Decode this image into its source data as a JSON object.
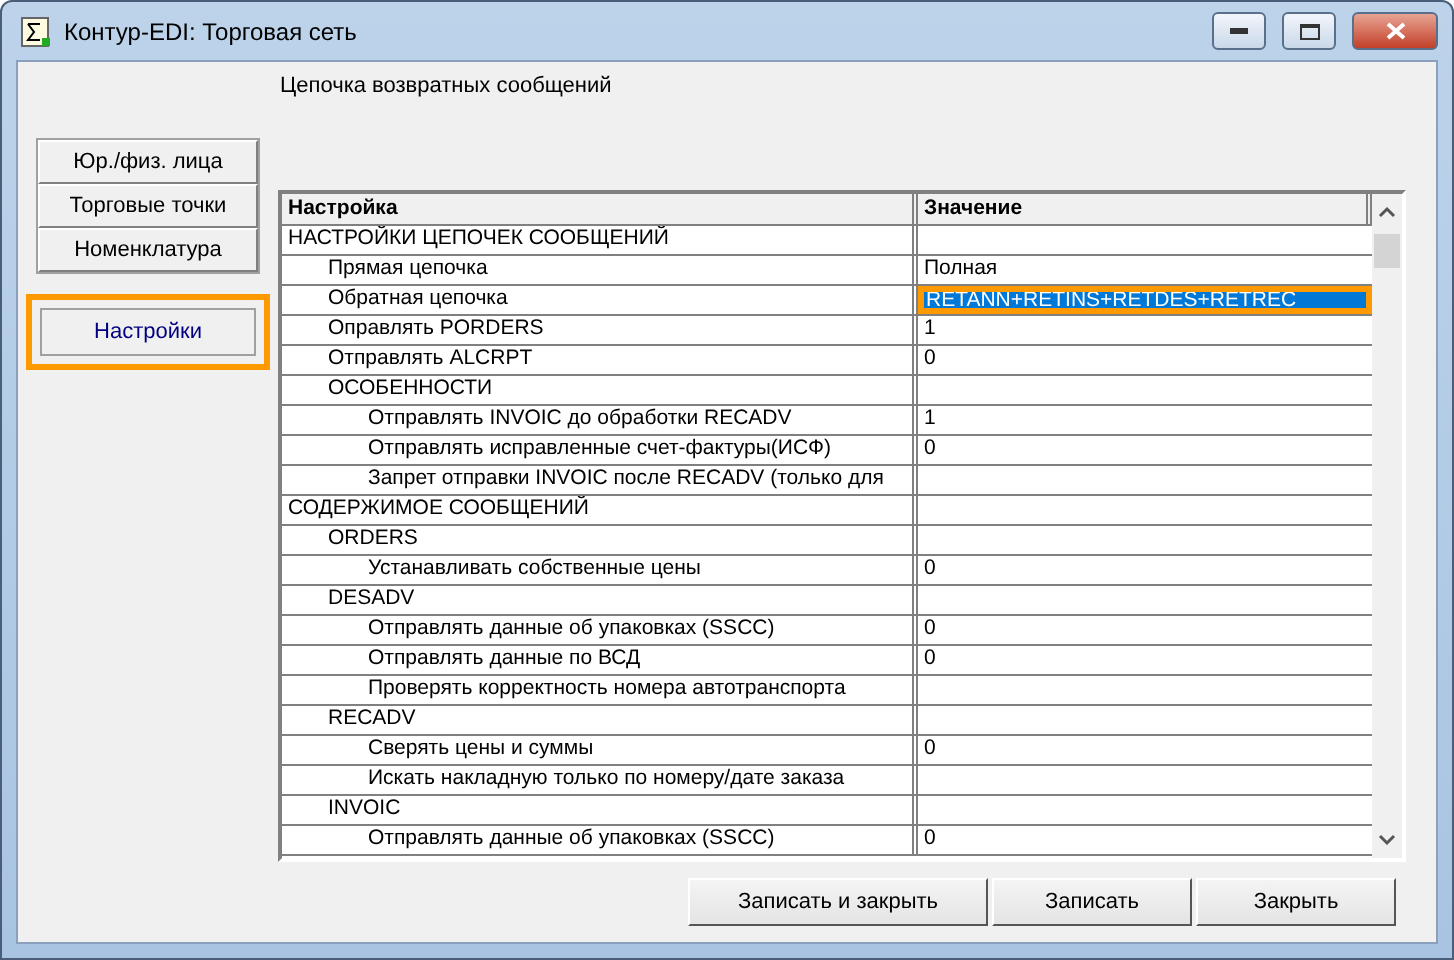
{
  "window": {
    "title": "Контур-EDI: Торговая сеть"
  },
  "caption": "Цепочка возвратных сообщений",
  "nav": [
    {
      "label": "Юр./физ. лица",
      "selected": false
    },
    {
      "label": "Торговые точки",
      "selected": false
    },
    {
      "label": "Номенклатура",
      "selected": false
    },
    {
      "label": "Настройки",
      "selected": true
    }
  ],
  "table": {
    "columns": [
      "Настройка",
      "Значение"
    ],
    "rows": [
      {
        "name": "НАСТРОЙКИ ЦЕПОЧЕК СООБЩЕНИЙ",
        "selected": false,
        "children": [
          {
            "name": "Прямая цепочка",
            "value": "Полная",
            "selected": false
          },
          {
            "name": "Обратная цепочка",
            "value": "RETANN+RETINS+RETDES+RETREC",
            "selected": true
          },
          {
            "name": "Оправлять PORDERS",
            "value": "1",
            "selected": false
          },
          {
            "name": "Отправлять ALCRPT",
            "value": "0",
            "selected": false
          },
          {
            "name": "ОСОБЕННОСТИ",
            "selected": false,
            "children": [
              {
                "name": "Отправлять INVOIC до обработки RECADV",
                "value": "1",
                "selected": false
              },
              {
                "name": "Отправлять исправленные счет-фактуры(ИСФ)",
                "value": "0",
                "selected": false
              },
              {
                "name": "Запрет отправки INVOIC после RECADV (только для",
                "selected": false
              }
            ]
          }
        ]
      },
      {
        "name": "СОДЕРЖИМОЕ СООБЩЕНИЙ",
        "selected": false,
        "children": [
          {
            "name": "ORDERS",
            "selected": false,
            "children": [
              {
                "name": "Устанавливать собственные цены",
                "value": "0",
                "selected": false
              }
            ]
          },
          {
            "name": "DESADV",
            "selected": false,
            "children": [
              {
                "name": "Отправлять данные об упаковках (SSCC)",
                "value": "0",
                "selected": false
              },
              {
                "name": "Отправлять данные по ВСД",
                "value": "0",
                "selected": false
              },
              {
                "name": "Проверять корректность номера автотранспорта",
                "selected": false
              }
            ]
          },
          {
            "name": "RECADV",
            "selected": false,
            "children": [
              {
                "name": "Сверять цены и суммы",
                "value": "0",
                "selected": false
              },
              {
                "name": "Искать накладную только по номеру/дате заказа",
                "selected": false
              }
            ]
          },
          {
            "name": "INVOIC",
            "selected": false,
            "children": [
              {
                "name": "Отправлять данные об упаковках (SSCC)",
                "value": "0",
                "selected": false
              }
            ]
          }
        ]
      }
    ]
  },
  "buttons": [
    "Записать и закрыть",
    "Записать",
    "Закрыть"
  ]
}
